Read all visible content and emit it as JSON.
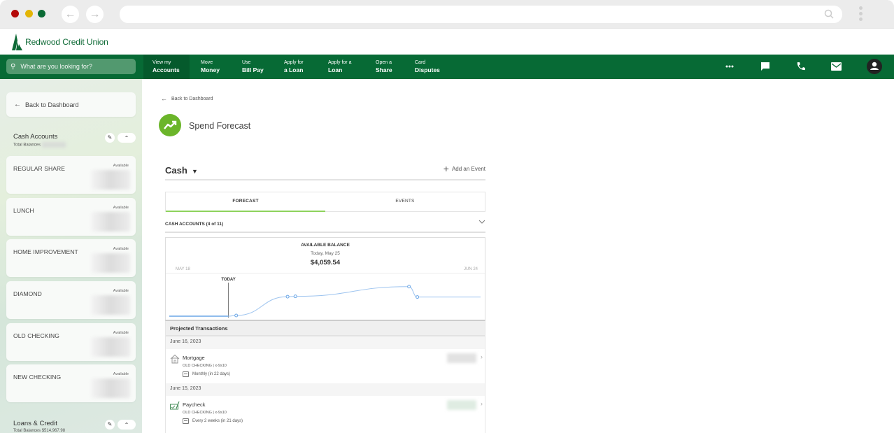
{
  "browser": {
    "back_icon": "arrow-left-icon",
    "forward_icon": "arrow-right-icon",
    "url_value": ""
  },
  "brand": {
    "name": "Redwood Credit Union",
    "primary_color": "#076a35",
    "accent_color": "#6bb52a"
  },
  "nav": {
    "search_placeholder": "What are you looking for?",
    "items": [
      {
        "line1": "View my",
        "line2": "Accounts",
        "active": true
      },
      {
        "line1": "Move",
        "line2": "Money"
      },
      {
        "line1": "Use",
        "line2": "Bill Pay"
      },
      {
        "line1": "Apply for",
        "line2": "a Loan"
      },
      {
        "line1": "Apply for a",
        "line2": "Loan"
      },
      {
        "line1": "Open a",
        "line2": "Share"
      },
      {
        "line1": "Card",
        "line2": "Disputes"
      }
    ],
    "icons": [
      "more-icon",
      "chat-icon",
      "phone-icon",
      "mail-icon",
      "profile-icon"
    ]
  },
  "sidebar": {
    "back_label": "Back to Dashboard",
    "cash_section": {
      "title": "Cash Accounts",
      "subtitle": "Total Balances"
    },
    "accounts": [
      {
        "name": "REGULAR SHARE",
        "status": "Available"
      },
      {
        "name": "LUNCH",
        "status": "Available"
      },
      {
        "name": "HOME IMPROVEMENT",
        "status": "Available"
      },
      {
        "name": "DIAMOND",
        "status": "Available"
      },
      {
        "name": "OLD CHECKING",
        "status": "Available"
      },
      {
        "name": "NEW CHECKING",
        "status": "Available"
      }
    ],
    "loans_section": {
      "title": "Loans & Credit",
      "subtitle": "Total Balances $514,967.98"
    }
  },
  "main": {
    "back_label": "Back to Dashboard",
    "page_title": "Spend Forecast",
    "category": "Cash",
    "add_event_label": "Add an Event",
    "tabs": [
      {
        "label": "FORECAST",
        "active": true
      },
      {
        "label": "EVENTS",
        "active": false
      }
    ],
    "accounts_filter": "CASH ACCOUNTS (4 of 11)",
    "chart": {
      "title": "AVAILABLE BALANCE",
      "date_label": "Today, May 25",
      "amount": "$4,059.54",
      "range_start": "MAY 18",
      "range_end": "JUN 24",
      "today_label": "TODAY"
    },
    "projected": {
      "heading": "Projected Transactions",
      "groups": [
        {
          "date": "June 16, 2023",
          "txn": {
            "icon": "house-icon",
            "name": "Mortgage",
            "account": "OLD CHECKING | x-9s10",
            "frequency": "Monthly (in 22 days)",
            "amount_tint": "#e2e2e2"
          }
        },
        {
          "date": "June 15, 2023",
          "txn": {
            "icon": "paycheck-icon",
            "name": "Paycheck",
            "account": "OLD CHECKING | x-9s10",
            "frequency": "Every 2 weeks (in 21 days)",
            "amount_tint": "#dfece2"
          }
        }
      ]
    }
  },
  "chart_data": {
    "type": "line",
    "title": "AVAILABLE BALANCE",
    "x_range": [
      "May 18",
      "Jun 24"
    ],
    "today_marker": "May 25",
    "series": [
      {
        "name": "Available Balance (relative)",
        "points": [
          {
            "x": 0.0,
            "y": 0.0
          },
          {
            "x": 0.19,
            "y": 0.0
          },
          {
            "x": 0.215,
            "y": 0.02
          },
          {
            "x": 0.38,
            "y": 0.58
          },
          {
            "x": 0.405,
            "y": 0.59
          },
          {
            "x": 0.77,
            "y": 0.88
          },
          {
            "x": 0.797,
            "y": 0.57
          },
          {
            "x": 1.0,
            "y": 0.57
          }
        ],
        "markers_at": [
          0.215,
          0.38,
          0.405,
          0.77,
          0.797
        ]
      }
    ],
    "grid": false,
    "legend": "none"
  }
}
